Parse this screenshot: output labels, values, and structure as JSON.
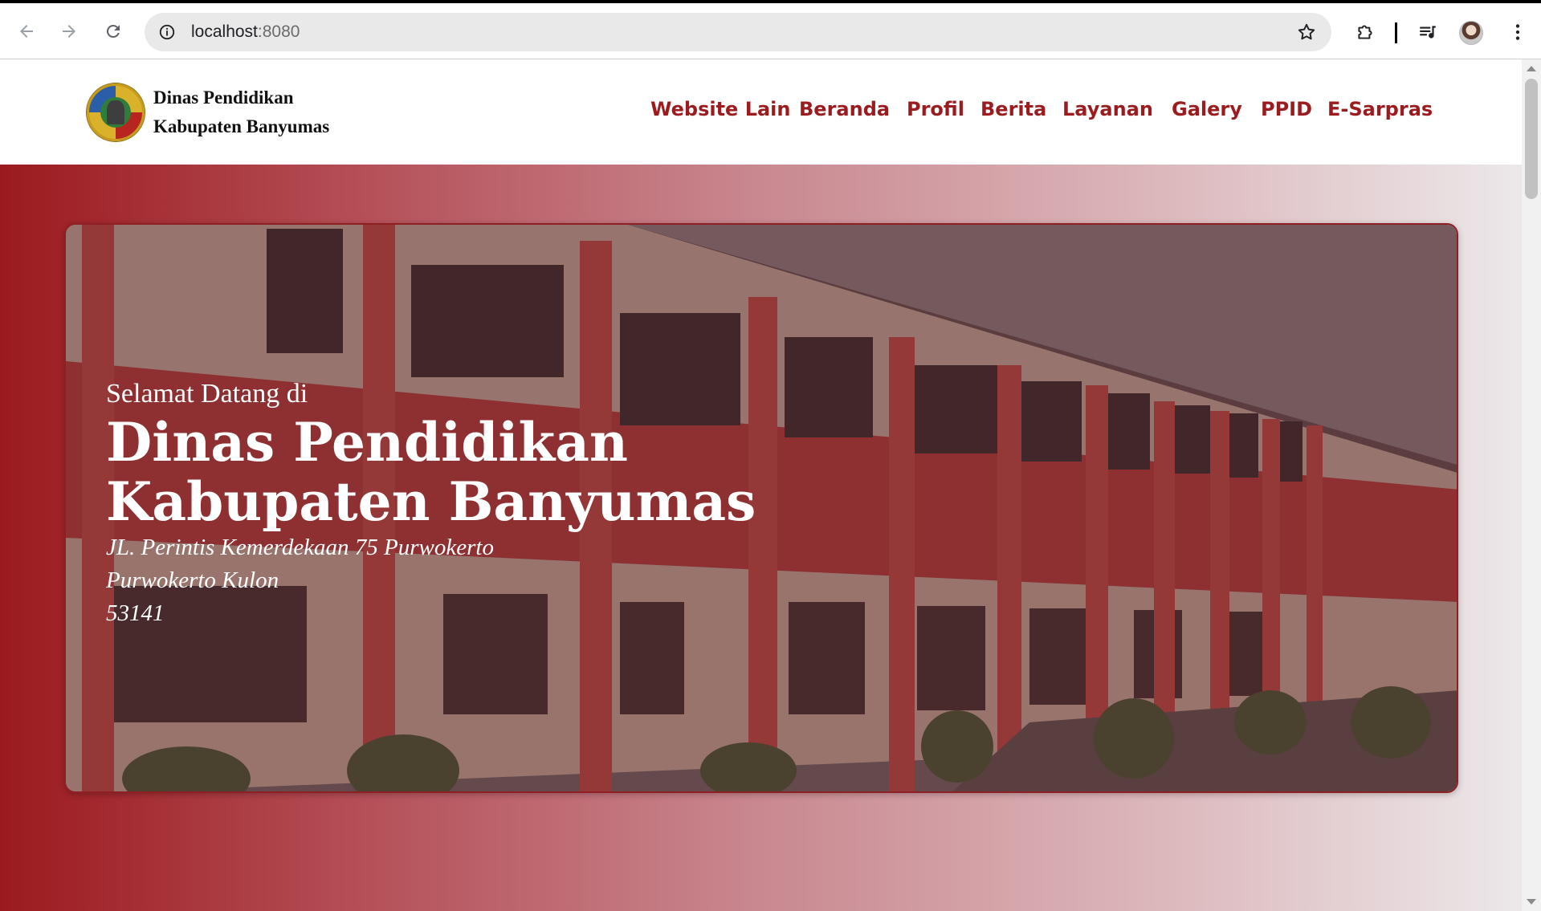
{
  "browser": {
    "url_host": "localhost",
    "url_port": ":8080",
    "icons": {
      "back": "arrow-left-icon",
      "forward": "arrow-right-icon",
      "reload": "reload-icon",
      "site_info": "info-icon",
      "bookmark": "star-icon",
      "extensions": "puzzle-icon",
      "media": "playlist-icon",
      "profile": "avatar",
      "menu": "kebab-icon"
    }
  },
  "header": {
    "brand_line1": "Dinas Pendidikan",
    "brand_line2": "Kabupaten Banyumas",
    "nav": [
      "Website Lain",
      "Beranda",
      "Profil",
      "Berita",
      "Layanan",
      "Galery",
      "PPID",
      "E-Sarpras"
    ]
  },
  "hero": {
    "greeting": "Selamat Datang di",
    "title_line1": "Dinas Pendidikan",
    "title_line2": "Kabupaten Banyumas",
    "address_line1": "JL. Perintis Kemerdekaan 75 Purwokerto",
    "address_line2": "Purwokerto Kulon",
    "address_line3": "53141"
  },
  "colors": {
    "brand_red": "#9b1b1f",
    "gradient_start": "#9b1a1f",
    "gradient_end": "#ece8ea"
  }
}
